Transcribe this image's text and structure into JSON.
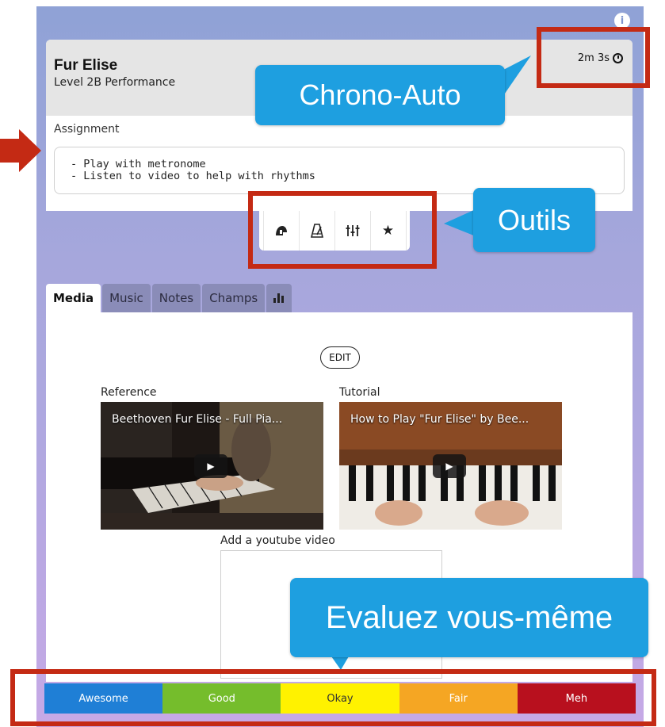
{
  "piece": {
    "title": "Fur Elise",
    "level": "Level 2B Performance",
    "timer": "2m 3s"
  },
  "assignment": {
    "label": "Assignment",
    "text": "- Play with metronome\n- Listen to video to help with rhythms"
  },
  "toolbar": {
    "icons": [
      "helmet-icon",
      "metronome-icon",
      "mixer-icon",
      "star-icon"
    ]
  },
  "tabs": [
    {
      "label": "Media",
      "active": true
    },
    {
      "label": "Music",
      "active": false
    },
    {
      "label": "Notes",
      "active": false
    },
    {
      "label": "Champs",
      "active": false
    },
    {
      "label": "",
      "icon": "bar-chart-icon",
      "active": false
    }
  ],
  "media": {
    "edit_label": "EDIT",
    "reference": {
      "label": "Reference",
      "video_title": "Beethoven Fur Elise - Full Pia..."
    },
    "tutorial": {
      "label": "Tutorial",
      "video_title": "How to Play \"Fur Elise\" by Bee..."
    },
    "add_label": "Add a youtube video"
  },
  "ratings": [
    {
      "label": "Awesome",
      "color": "#1f7fd6",
      "text_color": "#ffffff"
    },
    {
      "label": "Good",
      "color": "#75bd2c",
      "text_color": "#ffffff"
    },
    {
      "label": "Okay",
      "color": "#fff200",
      "text_color": "#333333"
    },
    {
      "label": "Fair",
      "color": "#f5a623",
      "text_color": "#ffffff"
    },
    {
      "label": "Meh",
      "color": "#b8101e",
      "text_color": "#ffffff"
    }
  ],
  "callouts": {
    "chrono": "Chrono-Auto",
    "outils": "Outils",
    "evaluez": "Evaluez vous-même"
  },
  "colors": {
    "callout": "#1e9fe0",
    "highlight": "#c42a14"
  }
}
